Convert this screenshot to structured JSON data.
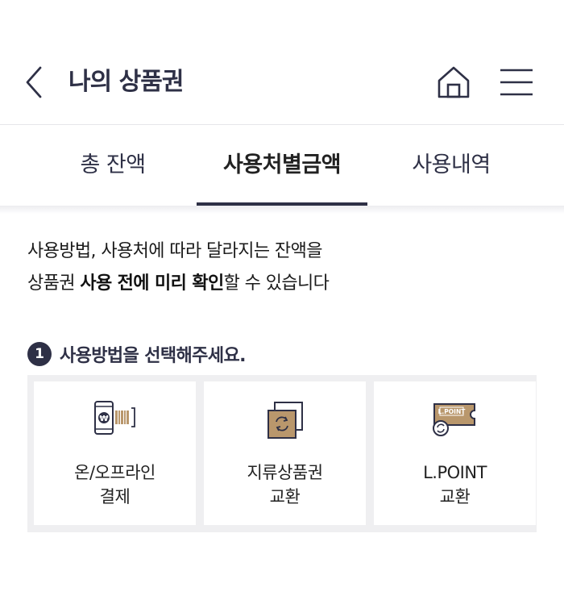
{
  "header": {
    "title": "나의 상품권",
    "back_icon": "chevron-left-icon",
    "home_icon": "home-icon",
    "menu_icon": "hamburger-menu-icon"
  },
  "tabs": [
    {
      "label": "총 잔액",
      "active": false
    },
    {
      "label": "사용처별금액",
      "active": true
    },
    {
      "label": "사용내역",
      "active": false
    }
  ],
  "description": {
    "line1": "사용방법, 사용처에 따라 달라지는 잔액을",
    "line2_prefix": "상품권 ",
    "line2_bold": "사용 전에 미리 확인",
    "line2_suffix": "할 수 있습니다"
  },
  "step": {
    "number": "1",
    "text": "사용방법을 선택해주세요."
  },
  "options": [
    {
      "line1": "온/오프라인",
      "line2": "결제",
      "icon": "mobile-barcode-payment-icon"
    },
    {
      "line1": "지류상품권",
      "line2": "교환",
      "icon": "paper-voucher-exchange-icon"
    },
    {
      "line1": "L.POINT",
      "line2": "교환",
      "icon": "lpoint-ticket-exchange-icon",
      "icon_text": "L.POINT"
    }
  ],
  "colors": {
    "primary": "#2e3046",
    "accent_gold": "#b9976c",
    "panel_bg": "#efeff1"
  }
}
